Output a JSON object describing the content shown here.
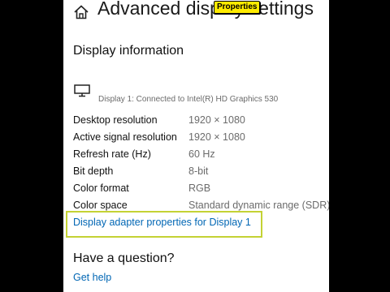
{
  "header": {
    "title": "Advanced display settings",
    "home_icon": "home-icon",
    "badge": "Properties",
    "badge_color": "#ffeb00"
  },
  "display_info": {
    "title": "Display information",
    "monitor_icon": "monitor-icon",
    "connection": "Display 1: Connected to Intel(R) HD Graphics 530",
    "rows": [
      {
        "label": "Desktop resolution",
        "value": "1920 × 1080"
      },
      {
        "label": "Active signal resolution",
        "value": "1920 × 1080"
      },
      {
        "label": "Refresh rate (Hz)",
        "value": "60 Hz"
      },
      {
        "label": "Bit depth",
        "value": "8-bit"
      },
      {
        "label": "Color format",
        "value": "RGB"
      },
      {
        "label": "Color space",
        "value": "Standard dynamic range (SDR)"
      }
    ],
    "adapter_link": "Display adapter properties for Display 1",
    "highlight_color": "#c4d234"
  },
  "question": {
    "title": "Have a question?",
    "help_link": "Get help"
  },
  "colors": {
    "link": "#0066b4",
    "secondary_text": "#6b6b6b"
  }
}
